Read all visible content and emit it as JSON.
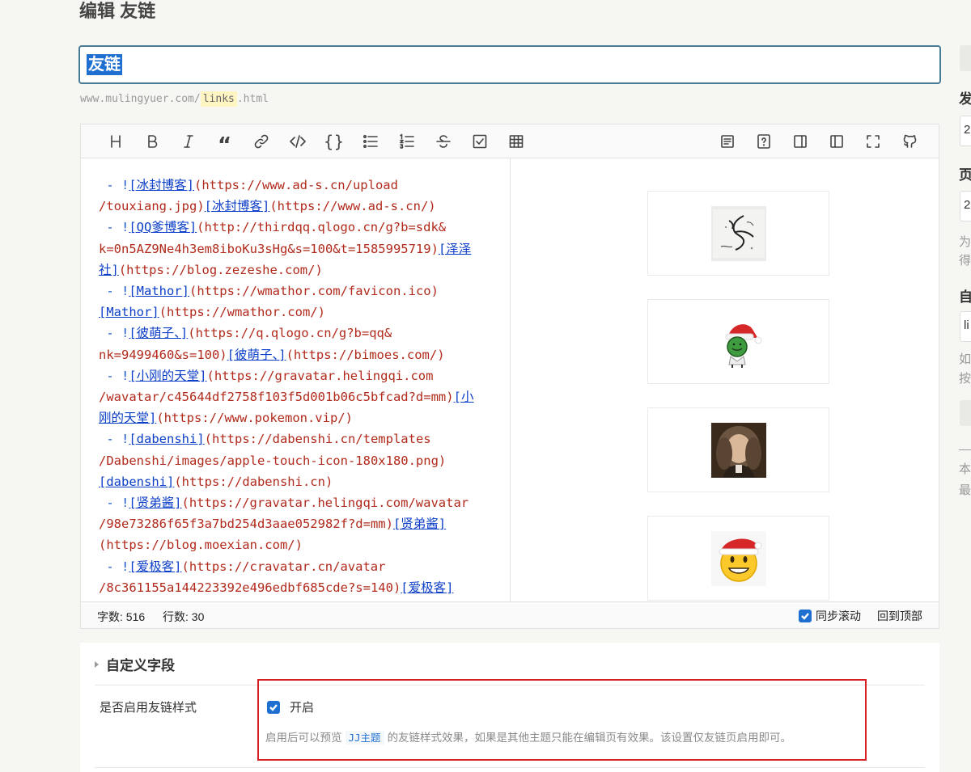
{
  "page": {
    "title": "编辑 友链"
  },
  "title_input": {
    "value": "友链"
  },
  "permalink": {
    "prefix": "www.mulingyuer.com/",
    "slug": "links",
    "suffix": ".html"
  },
  "toolbar": {
    "left": [
      {
        "name": "heading-icon"
      },
      {
        "name": "bold-icon"
      },
      {
        "name": "italic-icon"
      },
      {
        "name": "quote-icon"
      },
      {
        "name": "link-icon"
      },
      {
        "name": "code-icon"
      },
      {
        "name": "code-block-icon"
      },
      {
        "name": "unordered-list-icon"
      },
      {
        "name": "ordered-list-icon"
      },
      {
        "name": "strikethrough-icon"
      },
      {
        "name": "checkbox-icon"
      },
      {
        "name": "table-icon"
      }
    ],
    "right": [
      {
        "name": "toc-icon"
      },
      {
        "name": "help-icon"
      },
      {
        "name": "preview-right-icon"
      },
      {
        "name": "preview-left-icon"
      },
      {
        "name": "fullscreen-icon"
      },
      {
        "name": "github-icon"
      }
    ]
  },
  "code_lines": [
    [
      {
        "t": " - !",
        "c": "dash"
      },
      {
        "t": "[冰封博客]",
        "c": "lk"
      },
      {
        "t": "(https://www.ad-s.cn/upload"
      }
    ],
    [
      {
        "t": "/touxiang.jpg)"
      },
      {
        "t": "[冰封博客]",
        "c": "lk"
      },
      {
        "t": "(https://www.ad-s.cn/)"
      }
    ],
    [
      {
        "t": " - !",
        "c": "dash"
      },
      {
        "t": "[QQ爹博客]",
        "c": "lk"
      },
      {
        "t": "(http://thirdqq.qlogo.cn/g?b=sdk&"
      }
    ],
    [
      {
        "t": "k=0n5AZ9Ne4h3em8iboKu3sHg&s=100&t=1585995719)"
      },
      {
        "t": "[泽泽",
        "c": "lk"
      }
    ],
    [
      {
        "t": "社]",
        "c": "lk"
      },
      {
        "t": "(https://blog.zezeshe.com/)"
      }
    ],
    [
      {
        "t": " - !",
        "c": "dash"
      },
      {
        "t": "[Mathor]",
        "c": "lk"
      },
      {
        "t": "(https://wmathor.com/favicon.ico)"
      }
    ],
    [
      {
        "t": "[Mathor]",
        "c": "lk"
      },
      {
        "t": "(https://wmathor.com/)"
      }
    ],
    [
      {
        "t": " - !",
        "c": "dash"
      },
      {
        "t": "[彼萌子、]",
        "c": "lk"
      },
      {
        "t": "(https://q.qlogo.cn/g?b=qq&"
      }
    ],
    [
      {
        "t": "nk=9499460&s=100)"
      },
      {
        "t": "[彼萌子、]",
        "c": "lk"
      },
      {
        "t": "(https://bimoes.com/)"
      }
    ],
    [
      {
        "t": " - !",
        "c": "dash"
      },
      {
        "t": "[小刚的天堂]",
        "c": "lk"
      },
      {
        "t": "(https://gravatar.helingqi.com"
      }
    ],
    [
      {
        "t": "/wavatar/c45644df2758f103f5d001b06c5bfcad?d=mm)"
      },
      {
        "t": "[小",
        "c": "lk"
      }
    ],
    [
      {
        "t": "刚的天堂]",
        "c": "lk"
      },
      {
        "t": "(https://www.pokemon.vip/)"
      }
    ],
    [
      {
        "t": " - !",
        "c": "dash"
      },
      {
        "t": "[dabenshi]",
        "c": "lk"
      },
      {
        "t": "(https://dabenshi.cn/templates"
      }
    ],
    [
      {
        "t": "/Dabenshi/images/apple-touch-icon-180x180.png)"
      }
    ],
    [
      {
        "t": "[dabenshi]",
        "c": "lk"
      },
      {
        "t": "(https://dabenshi.cn)"
      }
    ],
    [
      {
        "t": " - !",
        "c": "dash"
      },
      {
        "t": "[贤弟酱]",
        "c": "lk"
      },
      {
        "t": "(https://gravatar.helingqi.com/wavatar"
      }
    ],
    [
      {
        "t": "/98e73286f65f3a7bd254d3aae052982f?d=mm)"
      },
      {
        "t": "[贤弟酱]",
        "c": "lk"
      }
    ],
    [
      {
        "t": "(https://blog.moexian.com/)"
      }
    ],
    [
      {
        "t": " - !",
        "c": "dash"
      },
      {
        "t": "[爱极客]",
        "c": "lk"
      },
      {
        "t": "(https://cravatar.cn/avatar"
      }
    ],
    [
      {
        "t": "/8c361155a144223392e496edbf685cde?s=140)"
      },
      {
        "t": "[爱极客]",
        "c": "lk"
      }
    ]
  ],
  "preview_cards": [
    {
      "name": "avatar-ink-sketch"
    },
    {
      "name": "avatar-green-santa-character"
    },
    {
      "name": "avatar-portrait-painting"
    },
    {
      "name": "avatar-santa-emoji"
    }
  ],
  "statusbar": {
    "word_count": "字数: 516",
    "line_count": "行数: 30",
    "sync_scroll_label": "同步滚动",
    "sync_scroll_checked": true,
    "back_to_top": "回到顶部"
  },
  "custom_fields": {
    "heading": "自定义字段",
    "field_label": "是否启用友链样式",
    "option_label": "开启",
    "option_checked": true,
    "desc_before": "启用后可以预览",
    "desc_code": "JJ主题",
    "desc_after": "的友链样式效果，如果是其他主题只能在编辑页有效果。该设置仅友链页启用即可。"
  },
  "sidebar_fragments": {
    "publish": "发",
    "publish_value": "2",
    "page": "页",
    "page_value": "2",
    "hint1": "为",
    "hint2": "得",
    "custom": "自",
    "custom_value": "li",
    "note1": "如",
    "note2": "按",
    "footer1": "本",
    "footer2": "最"
  },
  "colors": {
    "accent": "#1f6fd1",
    "highlight_border": "#d71f26",
    "code_text": "#b22a1c",
    "code_link": "#0b3ec8"
  }
}
